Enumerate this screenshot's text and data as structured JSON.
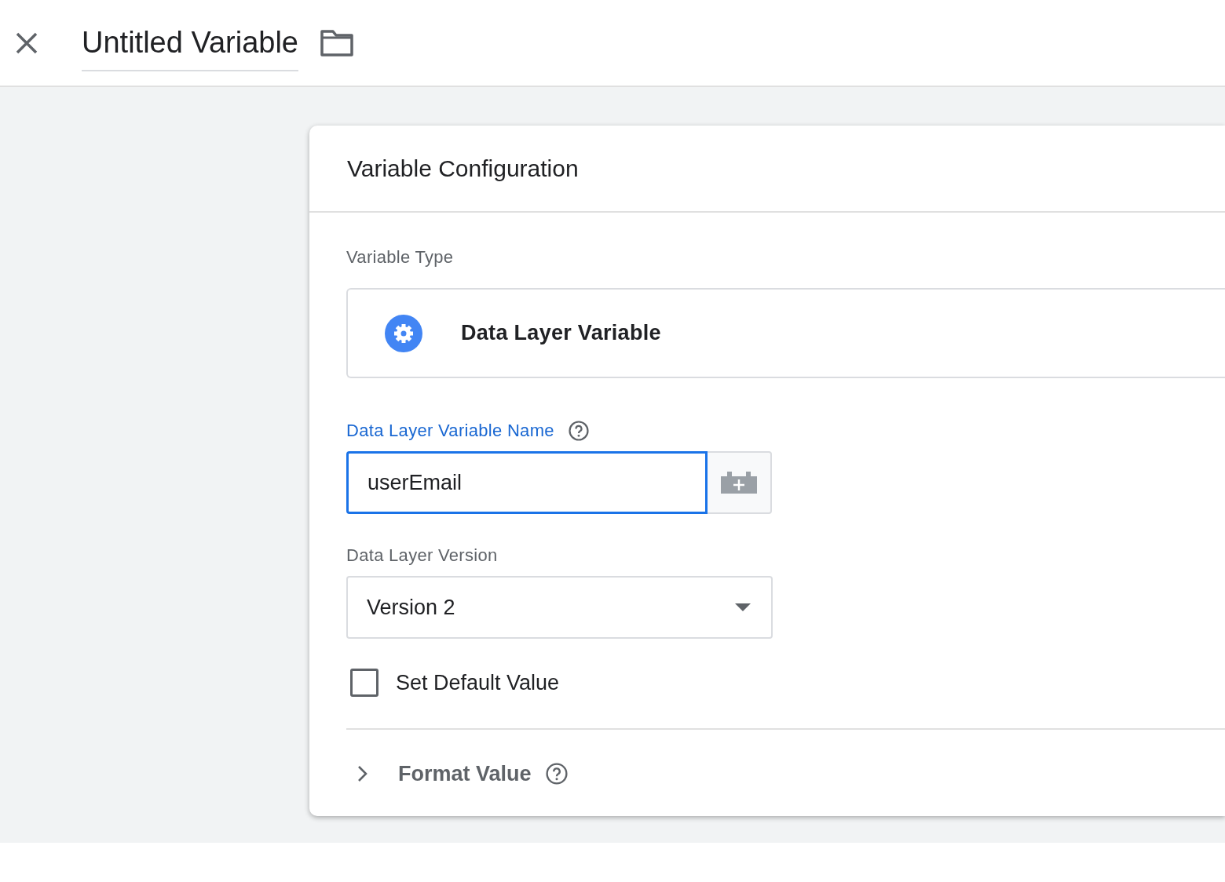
{
  "header": {
    "title": "Untitled Variable"
  },
  "card": {
    "title": "Variable Configuration"
  },
  "variable_type": {
    "label": "Variable Type",
    "value": "Data Layer Variable"
  },
  "name_field": {
    "label": "Data Layer Variable Name",
    "value": "userEmail",
    "focused": true
  },
  "version_field": {
    "label": "Data Layer Version",
    "value": "Version 2"
  },
  "default_value": {
    "label": "Set Default Value",
    "checked": false
  },
  "format_value": {
    "label": "Format Value",
    "expanded": false
  }
}
